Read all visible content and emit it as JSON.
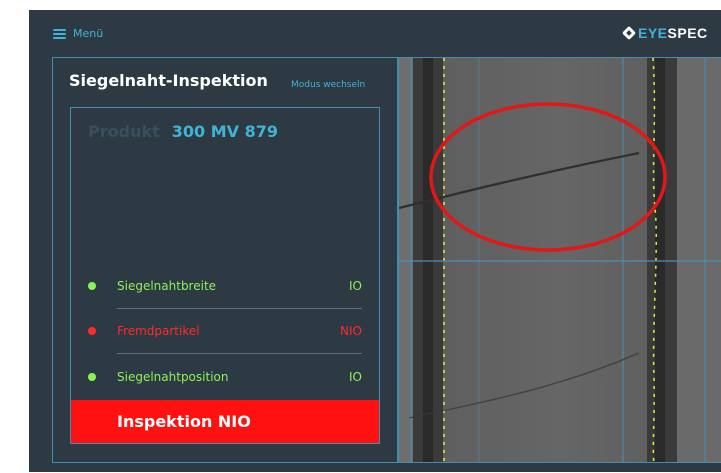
{
  "header": {
    "menu_label": "Menü",
    "logo_prefix": "EYE",
    "logo_suffix": "SPEC"
  },
  "panel": {
    "title": "Siegelnaht-Inspektion",
    "mode_switch_label": "Modus wechseln",
    "product_label": "Produkt",
    "product_value": "300 MV 879"
  },
  "checks": [
    {
      "label": "Siegelnahtbreite",
      "status": "IO",
      "state": "ok"
    },
    {
      "label": "Fremdpartikel",
      "status": "NIO",
      "state": "nio"
    },
    {
      "label": "Siegelnahtposition",
      "status": "IO",
      "state": "ok"
    }
  ],
  "result": {
    "text": "Inspektion NIO",
    "color": "#ff1111"
  },
  "colors": {
    "accent": "#3fb4d6",
    "ok": "#8cf25a",
    "nio": "#ff2a2a",
    "background": "#2d3a44"
  },
  "icons": {
    "menu": "hamburger-icon",
    "logo": "diamond-logo-icon",
    "status_dot": "status-dot-icon"
  }
}
